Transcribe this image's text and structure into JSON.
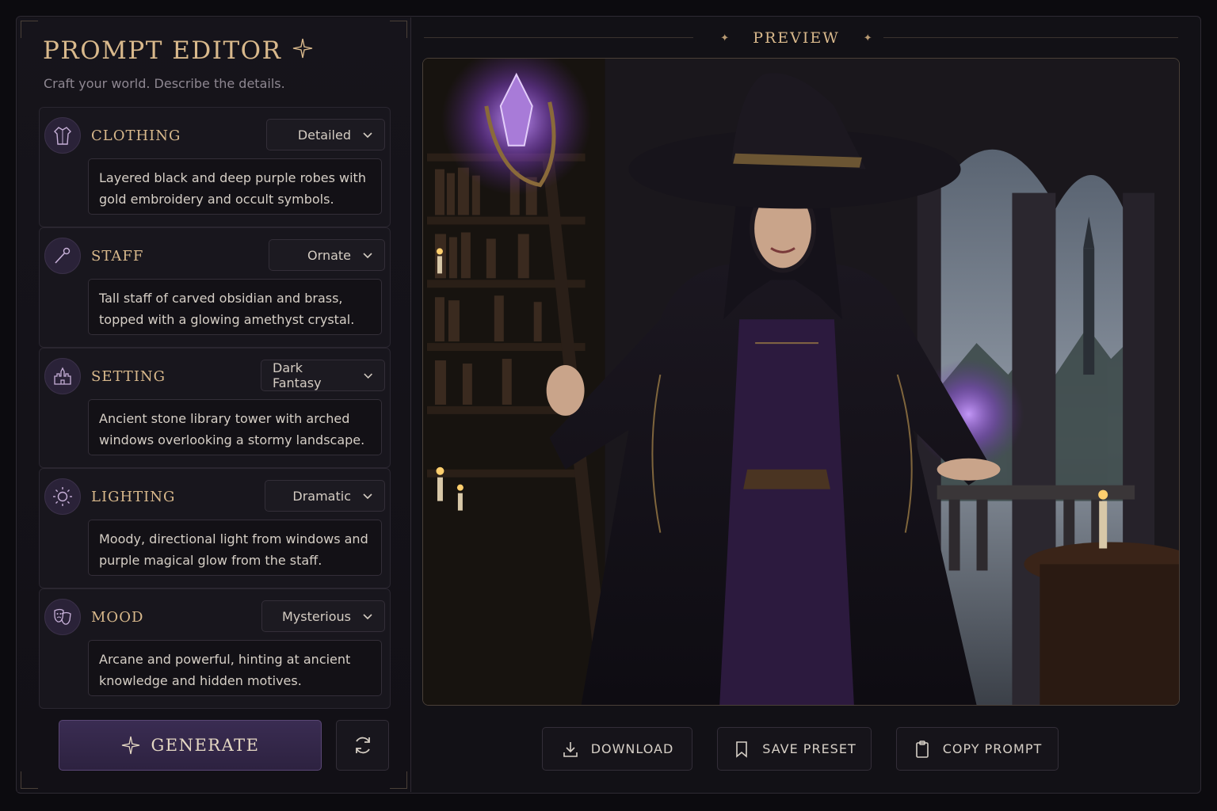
{
  "editor": {
    "title": "PROMPT EDITOR",
    "subtitle": "Craft your world. Describe the details.",
    "sections": [
      {
        "label": "CLOTHING",
        "option": "Detailed",
        "description": "Layered black and deep purple robes with gold embroidery and occult symbols.",
        "icon": "robe-icon"
      },
      {
        "label": "STAFF",
        "option": "Ornate",
        "description": "Tall staff of carved obsidian and brass, topped with a glowing amethyst crystal.",
        "icon": "wand-icon"
      },
      {
        "label": "SETTING",
        "option": "Dark Fantasy",
        "description": "Ancient stone library tower with arched windows overlooking a stormy landscape.",
        "icon": "castle-icon"
      },
      {
        "label": "LIGHTING",
        "option": "Dramatic",
        "description": "Moody, directional light from windows and purple magical glow from the staff.",
        "icon": "sun-icon"
      },
      {
        "label": "MOOD",
        "option": "Mysterious",
        "description": "Arcane and powerful, hinting at ancient knowledge and hidden motives.",
        "icon": "theater-masks-icon"
      }
    ],
    "generate_label": "GENERATE"
  },
  "preview": {
    "title": "PREVIEW",
    "actions": {
      "download": "DOWNLOAD",
      "save_preset": "SAVE PRESET",
      "copy_prompt": "COPY PROMPT"
    }
  },
  "colors": {
    "accent_gold": "#d9b98c",
    "accent_purple": "#3a2c52",
    "background": "#0c0b0f"
  }
}
